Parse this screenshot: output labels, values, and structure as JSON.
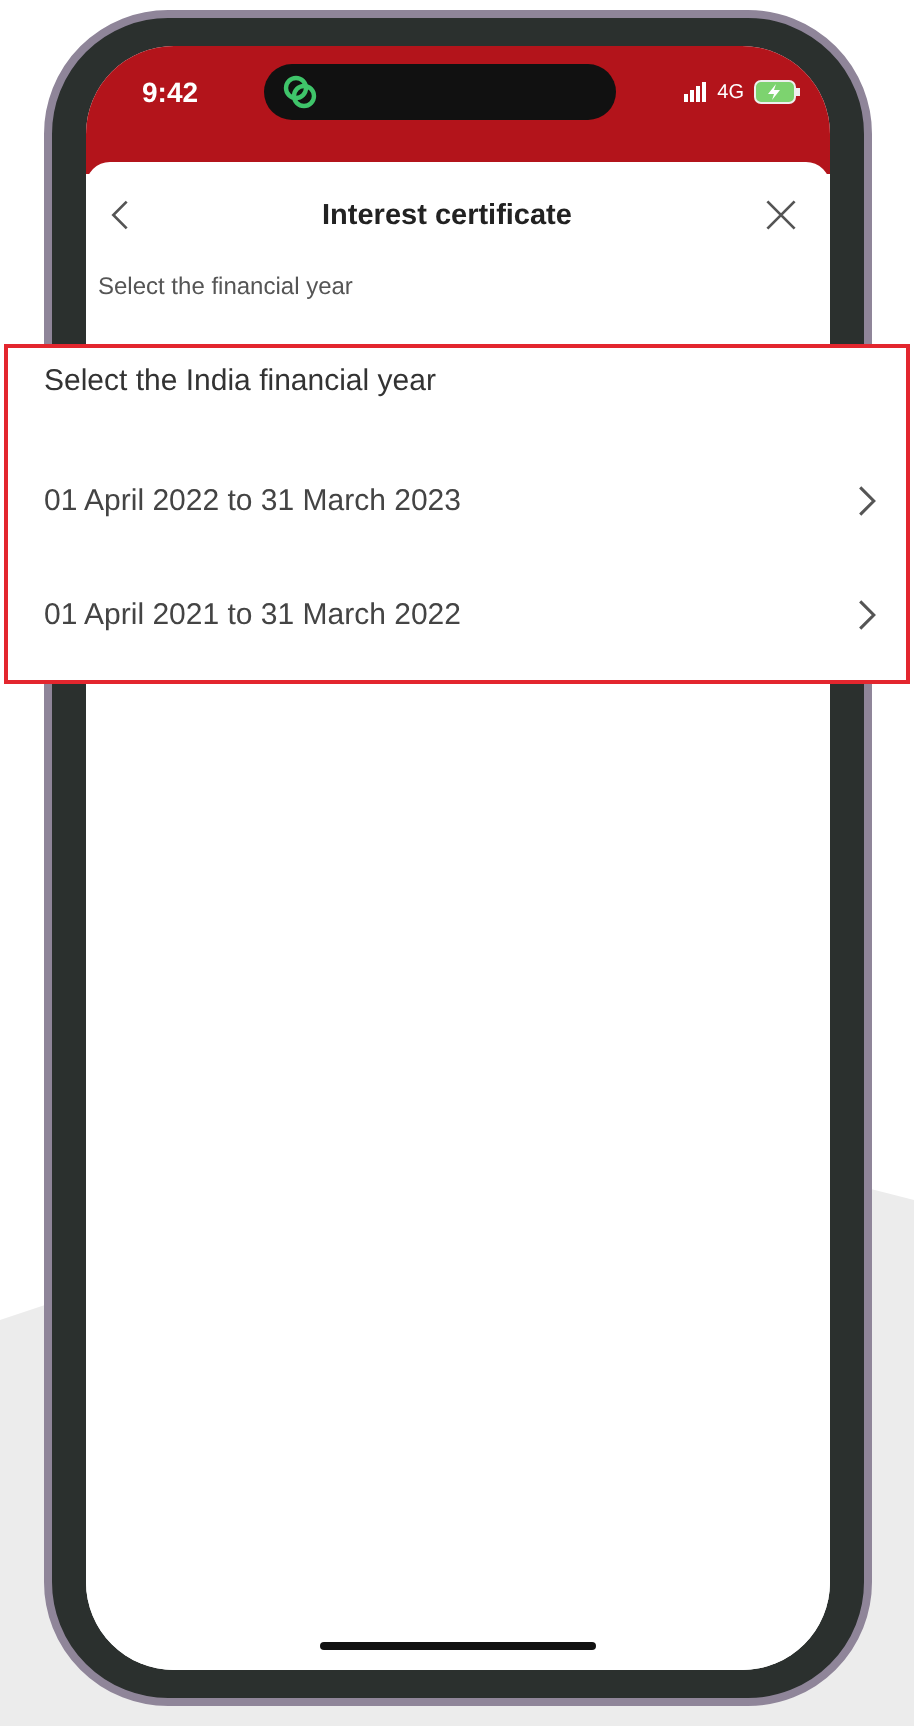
{
  "status_bar": {
    "time": "9:42",
    "network": "4G"
  },
  "header": {
    "title": "Interest certificate"
  },
  "prompt": "Select the financial year",
  "callout": {
    "heading": "Select the India financial year",
    "options": [
      {
        "label": "01 April 2022 to 31 March 2023"
      },
      {
        "label": "01 April 2021 to 31 March 2022"
      }
    ]
  }
}
